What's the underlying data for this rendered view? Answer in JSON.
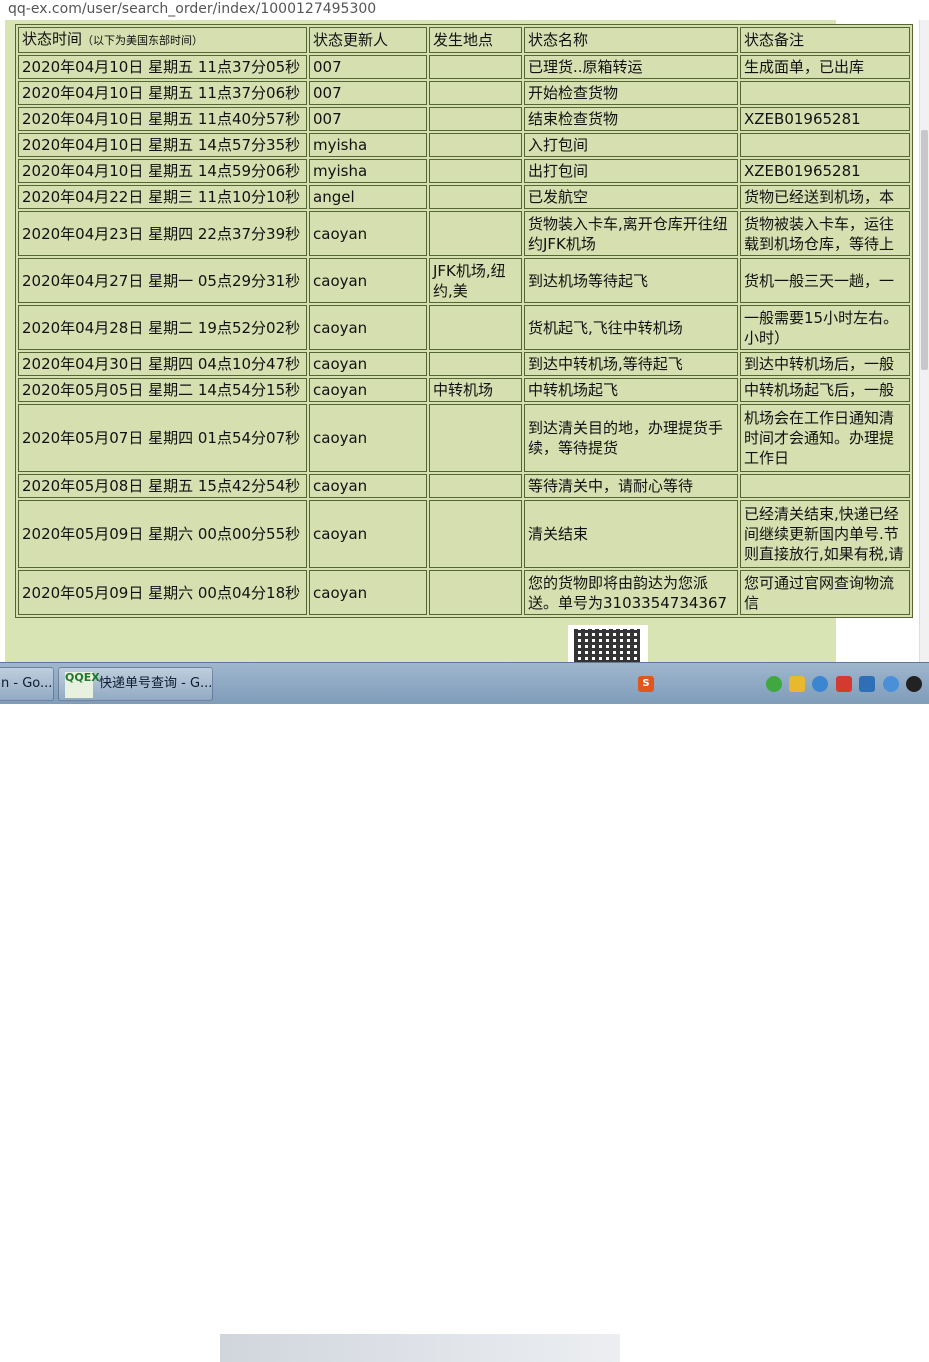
{
  "browser": {
    "url": "qq-ex.com/user/search_order/index/1000127495300"
  },
  "table": {
    "headers": {
      "time": "状态时间",
      "time_note": "（以下为美国东部时间）",
      "updater": "状态更新人",
      "location": "发生地点",
      "status": "状态名称",
      "remark": "状态备注"
    },
    "rows": [
      {
        "time": "2020年04月10日 星期五 11点37分05秒",
        "updater": "007",
        "location": "",
        "status": "已理货..原箱转运",
        "remark": "生成面单，已出库"
      },
      {
        "time": "2020年04月10日 星期五 11点37分06秒",
        "updater": "007",
        "location": "",
        "status": "开始检查货物",
        "remark": ""
      },
      {
        "time": "2020年04月10日 星期五 11点40分57秒",
        "updater": "007",
        "location": "",
        "status": "结束检查货物",
        "remark": "XZEB01965281"
      },
      {
        "time": "2020年04月10日 星期五 14点57分35秒",
        "updater": "myisha",
        "location": "",
        "status": "入打包间",
        "remark": ""
      },
      {
        "time": "2020年04月10日 星期五 14点59分06秒",
        "updater": "myisha",
        "location": "",
        "status": "出打包间",
        "remark": "XZEB01965281"
      },
      {
        "time": "2020年04月22日 星期三 11点10分10秒",
        "updater": "angel",
        "location": "",
        "status": "已发航空",
        "remark": "货物已经送到机场，本"
      },
      {
        "time": "2020年04月23日 星期四 22点37分39秒",
        "updater": "caoyan",
        "location": "",
        "status": "货物装入卡车,离开仓库开往纽约JFK机场",
        "remark": "货物被装入卡车，运往载到机场仓库，等待上"
      },
      {
        "time": "2020年04月27日 星期一 05点29分31秒",
        "updater": "caoyan",
        "location": "JFK机场,纽约,美",
        "status": "到达机场等待起飞",
        "remark": "货机一般三天一趟，一"
      },
      {
        "time": "2020年04月28日 星期二 19点52分02秒",
        "updater": "caoyan",
        "location": "",
        "status": "货机起飞,飞往中转机场",
        "remark": "一般需要15小时左右。小时）"
      },
      {
        "time": "2020年04月30日 星期四 04点10分47秒",
        "updater": "caoyan",
        "location": "",
        "status": "到达中转机场,等待起飞",
        "remark": "到达中转机场后，一般"
      },
      {
        "time": "2020年05月05日 星期二 14点54分15秒",
        "updater": "caoyan",
        "location": "中转机场",
        "status": "中转机场起飞",
        "remark": "中转机场起飞后，一般"
      },
      {
        "time": "2020年05月07日 星期四 01点54分07秒",
        "updater": "caoyan",
        "location": "",
        "status": "到达清关目的地，办理提货手续，等待提货",
        "remark": "机场会在工作日通知清时间才会通知。办理提工作日"
      },
      {
        "time": "2020年05月08日 星期五 15点42分54秒",
        "updater": "caoyan",
        "location": "",
        "status": "等待清关中，请耐心等待",
        "remark": ""
      },
      {
        "time": "2020年05月09日 星期六 00点00分55秒",
        "updater": "caoyan",
        "location": "",
        "status": "清关结束",
        "remark": "已经清关结束,快递已经间继续更新国内单号.节则直接放行,如果有税,请"
      },
      {
        "time": "2020年05月09日 星期六 00点04分18秒",
        "updater": "caoyan",
        "location": "",
        "status": "您的货物即将由韵达为您派送。单号为3103354734367",
        "remark": "您可通过官网查询物流信"
      }
    ]
  },
  "taskbar": {
    "task1_label": "n - Go...",
    "task2_label": "快递单号查询 - G...",
    "logo_text": "QQEX"
  },
  "colors": {
    "page_bg": "#d9e4b5",
    "cell_border": "#556633",
    "taskbar": "#8fa9c6"
  },
  "icons": [
    "qr-code-icon",
    "wechat-icon",
    "shield-icon",
    "network-icon",
    "ime-icon",
    "chat-icon",
    "sogou-icon"
  ]
}
